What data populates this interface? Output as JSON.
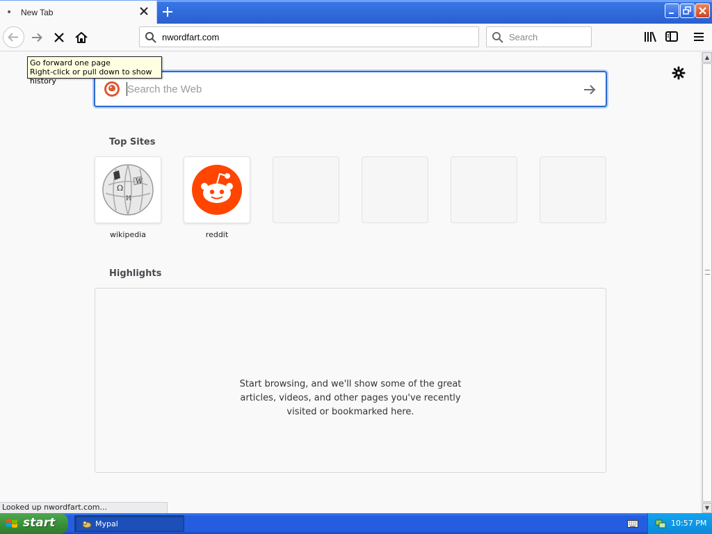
{
  "browser": {
    "tab": {
      "title": "New Tab",
      "close_icon": "close-icon"
    },
    "new_tab_icon": "plus-icon",
    "window_controls": [
      "minimize-icon",
      "restore-icon",
      "close-icon"
    ],
    "nav": {
      "back_icon": "back-arrow-icon",
      "forward_icon": "forward-arrow-icon",
      "stop_icon": "stop-icon",
      "home_icon": "home-icon"
    },
    "url": "nwordfart.com",
    "search_placeholder": "Search",
    "toolbar_icons": [
      "library-icon",
      "sidebar-icon",
      "hamburger-menu-icon"
    ]
  },
  "tooltip": {
    "line1": "Go forward one page",
    "line2": "Right-click or pull down to show history"
  },
  "newtab": {
    "web_search_placeholder": "Search the Web",
    "top_sites_title": "Top Sites",
    "top_sites": [
      {
        "label": "wikipedia",
        "icon": "wikipedia-globe-icon"
      },
      {
        "label": "reddit",
        "icon": "reddit-icon"
      },
      {
        "label": ""
      },
      {
        "label": ""
      },
      {
        "label": ""
      },
      {
        "label": ""
      }
    ],
    "highlights_title": "Highlights",
    "highlights_message": "Start browsing, and we'll show some of the great articles, videos, and other pages you've recently visited or bookmarked here."
  },
  "status_text": "Looked up nwordfart.com...",
  "taskbar": {
    "start_label": "start",
    "task_label": "Mypal",
    "clock": "10:57 PM"
  },
  "colors": {
    "accent_focus": "#2a6acf",
    "reddit_orange": "#ff4500",
    "taskbar_blue": "#245de0",
    "start_green": "#3b923b"
  }
}
